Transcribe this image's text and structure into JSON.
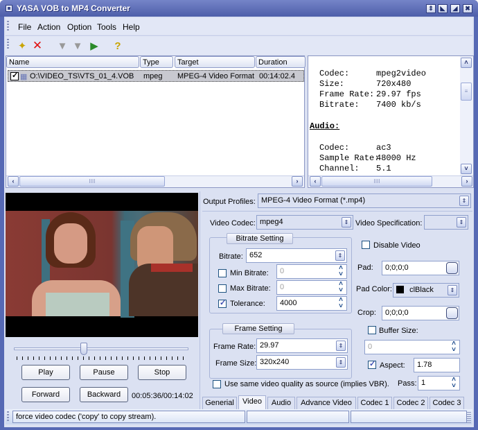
{
  "window": {
    "title": "YASA VOB to MP4 Converter",
    "controls": [
      "restore-icon",
      "minimize-icon",
      "maximize-icon",
      "close-icon"
    ]
  },
  "menu": {
    "items": [
      "File",
      "Action",
      "Option",
      "Tools",
      "Help"
    ]
  },
  "toolbar": {
    "buttons": [
      {
        "icon": "magic-wand-add-icon",
        "enabled": true
      },
      {
        "icon": "delete-x-icon",
        "enabled": true
      },
      {
        "icon": "funnel-convert-icon",
        "enabled": false
      },
      {
        "icon": "funnel-convert-all-icon",
        "enabled": false
      },
      {
        "icon": "funnel-start-icon",
        "enabled": true
      },
      {
        "icon": "help-document-icon",
        "enabled": true
      }
    ]
  },
  "file_list": {
    "columns": [
      "Name",
      "Type",
      "Target",
      "Duration"
    ],
    "rows": [
      {
        "checked": true,
        "name": "O:\\VIDEO_TS\\VTS_01_4.VOB",
        "type": "mpeg",
        "target": "MPEG-4 Video Format",
        "duration": "00:14:02.4"
      }
    ]
  },
  "info_panel": {
    "video": [
      {
        "label": "Codec:",
        "value": "mpeg2video"
      },
      {
        "label": "Size:",
        "value": "720x480"
      },
      {
        "label": "Frame Rate:",
        "value": "29.97 fps"
      },
      {
        "label": "Bitrate:",
        "value": "7400 kb/s"
      }
    ],
    "audio_heading": "Audio:",
    "audio": [
      {
        "label": "Codec:",
        "value": "ac3"
      },
      {
        "label": "Sample Rate:",
        "value": "48000 Hz"
      },
      {
        "label": "Channel:",
        "value": "5.1"
      }
    ]
  },
  "player": {
    "position_fraction": 0.4,
    "buttons": {
      "play": "Play",
      "pause": "Pause",
      "stop": "Stop",
      "forward": "Forward",
      "backward": "Backward"
    },
    "time": "00:05:36/00:14:02"
  },
  "settings": {
    "output_profiles_label": "Output Profiles:",
    "output_profile": "MPEG-4 Video Format (*.mp4)",
    "video_codec_label": "Video Codec:",
    "video_codec": "mpeg4",
    "video_spec_label": "Video Specification:",
    "video_spec": "",
    "bitrate_group": "Bitrate Setting",
    "bitrate_label": "Bitrate:",
    "bitrate": "652",
    "min_bitrate_label": "Min Bitrate:",
    "min_bitrate": "0",
    "min_bitrate_checked": false,
    "max_bitrate_label": "Max Bitrate:",
    "max_bitrate": "0",
    "max_bitrate_checked": false,
    "tolerance_label": "Tolerance:",
    "tolerance": "4000",
    "tolerance_checked": true,
    "disable_video_label": "Disable Video",
    "disable_video_checked": false,
    "pad_label": "Pad:",
    "pad": "0;0;0;0",
    "pad_color_label": "Pad Color:",
    "pad_color": "clBlack",
    "pad_color_swatch": "#000000",
    "crop_label": "Crop:",
    "crop": "0;0;0;0",
    "frame_group": "Frame Setting",
    "frame_rate_label": "Frame Rate:",
    "frame_rate": "29.97",
    "frame_size_label": "Frame Size:",
    "frame_size": "320x240",
    "buffer_size_label": "Buffer Size:",
    "buffer_size_checked": false,
    "buffer_size": "0",
    "aspect_label": "Aspect:",
    "aspect_checked": true,
    "aspect": "1.78",
    "same_quality_label": "Use same video quality as source (implies VBR).",
    "same_quality_checked": false,
    "pass_label": "Pass:",
    "pass": "1"
  },
  "tabs": [
    {
      "label": "Generial",
      "active": false
    },
    {
      "label": "Video",
      "active": true
    },
    {
      "label": "Audio",
      "active": false
    },
    {
      "label": "Advance Video",
      "active": false
    },
    {
      "label": "Codec 1",
      "active": false
    },
    {
      "label": "Codec 2",
      "active": false
    },
    {
      "label": "Codec 3",
      "active": false
    }
  ],
  "status": {
    "text": "force video codec ('copy' to copy stream).",
    "panel2": "",
    "panel3": ""
  }
}
